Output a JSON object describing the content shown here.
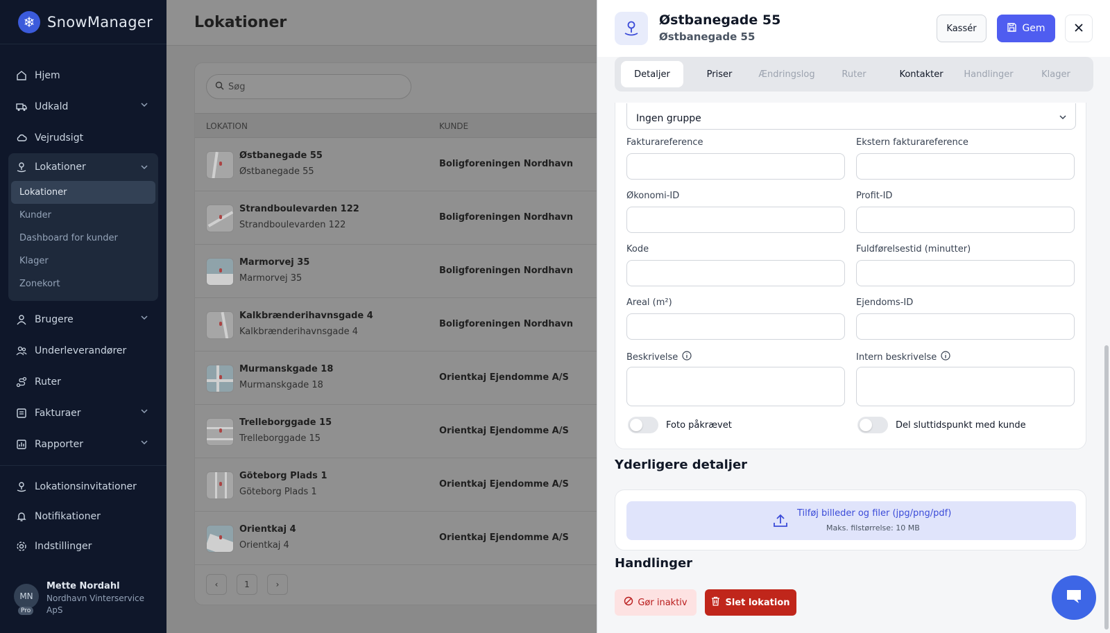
{
  "app": {
    "name": "SnowManager"
  },
  "sidebar": {
    "items": [
      {
        "label": "Hjem",
        "icon": "home-icon"
      },
      {
        "label": "Udkald",
        "icon": "truck-icon",
        "expandable": true
      },
      {
        "label": "Vejrudsigt",
        "icon": "cloud-icon"
      },
      {
        "label": "Lokationer",
        "icon": "location-icon",
        "expandable": true,
        "expanded": true
      },
      {
        "label": "Brugere",
        "icon": "users-icon",
        "expandable": true
      },
      {
        "label": "Underleverandører",
        "icon": "contractors-icon"
      },
      {
        "label": "Ruter",
        "icon": "route-icon"
      },
      {
        "label": "Fakturaer",
        "icon": "invoice-icon",
        "expandable": true
      },
      {
        "label": "Rapporter",
        "icon": "chart-icon",
        "expandable": true
      }
    ],
    "lokationer_sub": [
      "Lokationer",
      "Kunder",
      "Dashboard for kunder",
      "Klager",
      "Zonekort"
    ],
    "bottom_items": [
      {
        "label": "Lokationsinvitationer",
        "icon": "location-invite-icon"
      },
      {
        "label": "Notifikationer",
        "icon": "bell-icon"
      },
      {
        "label": "Indstillinger",
        "icon": "gear-icon"
      }
    ],
    "user": {
      "initials": "MN",
      "badge": "Pro",
      "name": "Mette Nordahl",
      "company": "Nordhavn Vinterservice ApS"
    }
  },
  "main": {
    "title": "Lokationer",
    "search_placeholder": "Søg",
    "columns": [
      "LOKATION",
      "KUNDE"
    ],
    "rows": [
      {
        "name": "Østbanegade 55",
        "address": "Østbanegade 55",
        "customer": "Boligforeningen Nordhavn"
      },
      {
        "name": "Strandboulevarden 122",
        "address": "Strandboulevarden 122",
        "customer": "Boligforeningen Nordhavn"
      },
      {
        "name": "Marmorvej 35",
        "address": "Marmorvej 35",
        "customer": "Boligforeningen Nordhavn"
      },
      {
        "name": "Kalkbrænderihavnsgade 4",
        "address": "Kalkbrænderihavnsgade 4",
        "customer": "Boligforeningen Nordhavn"
      },
      {
        "name": "Murmanskgade 18",
        "address": "Murmanskgade 18",
        "customer": "Orientkaj Ejendomme A/S"
      },
      {
        "name": "Trelleborggade 15",
        "address": "Trelleborggade 15",
        "customer": "Orientkaj Ejendomme A/S"
      },
      {
        "name": "Göteborg Plads 1",
        "address": "Göteborg Plads 1",
        "customer": "Orientkaj Ejendomme A/S"
      },
      {
        "name": "Orientkaj 4",
        "address": "Orientkaj 4",
        "customer": "Orientkaj Ejendomme A/S"
      }
    ],
    "pager": {
      "prev": "‹",
      "current": "1",
      "next": "›"
    }
  },
  "drawer": {
    "title": "Østbanegade 55",
    "subtitle": "Østbanegade 55",
    "cancel_label": "Kassér",
    "save_label": "Gem",
    "tabs": [
      {
        "label": "Detaljer",
        "active": true
      },
      {
        "label": "Priser"
      },
      {
        "label": "Ændringslog",
        "muted": true
      },
      {
        "label": "Ruter",
        "muted": true
      },
      {
        "label": "Kontakter"
      },
      {
        "label": "Handlinger",
        "muted": true
      },
      {
        "label": "Klager",
        "muted": true
      }
    ],
    "group_select": "Ingen gruppe",
    "fields": {
      "fakturareference": "Fakturareference",
      "ekstern_fakturareference": "Ekstern fakturareference",
      "okonomi_id": "Økonomi-ID",
      "profit_id": "Profit-ID",
      "kode": "Kode",
      "fuldforelsestid": "Fuldførelsestid (minutter)",
      "areal": "Areal (m²)",
      "ejendoms_id": "Ejendoms-ID",
      "beskrivelse": "Beskrivelse",
      "intern_beskrivelse": "Intern beskrivelse"
    },
    "toggles": {
      "foto": {
        "label": "Foto påkrævet",
        "on": false
      },
      "del_sluttid": {
        "label": "Del sluttidspunkt med kunde",
        "on": false
      }
    },
    "extra_title": "Yderligere detaljer",
    "upload": {
      "main": "Tilføj billeder og filer (jpg/png/pdf)",
      "sub": "Maks. filstørrelse: 10 MB"
    },
    "actions_title": "Handlinger",
    "inactive_label": "Gør inaktiv",
    "delete_label": "Slet lokation"
  },
  "colors": {
    "primary": "#4f5df0",
    "danger": "#c0261b",
    "sidebar_bg": "#0f172a"
  }
}
